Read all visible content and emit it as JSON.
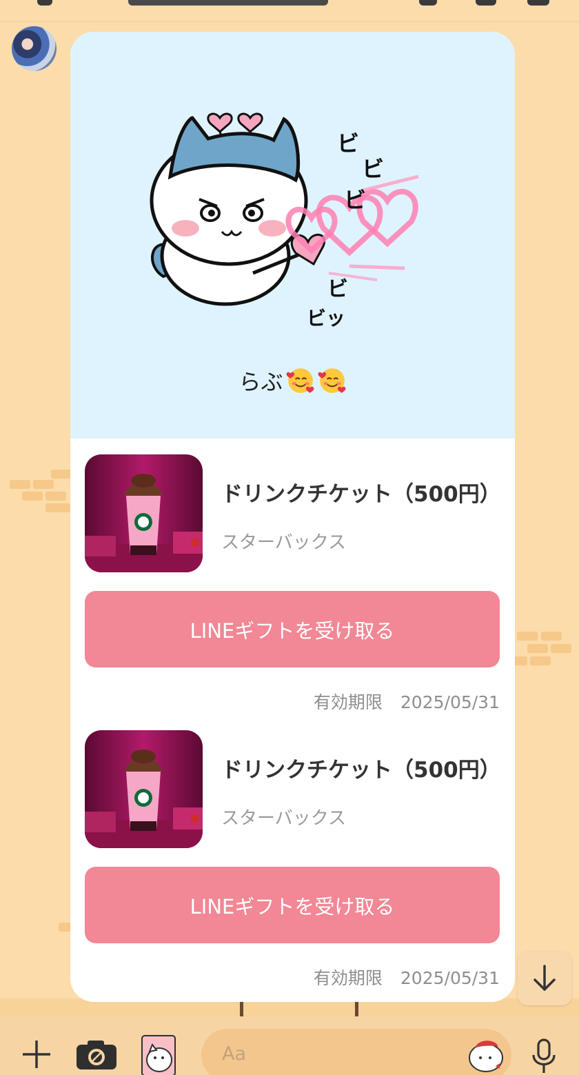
{
  "chat": {
    "message_text": "らぶ",
    "message_emoji": [
      "smiling-face-with-hearts",
      "smiling-face-with-hearts"
    ]
  },
  "sticker": {
    "icon": "chiikawa-cat-sticker",
    "text_parts": [
      "ビ",
      "ビ",
      "ビ",
      "ビ",
      "ビッ"
    ]
  },
  "gifts": [
    {
      "title": "ドリンクチケット（500円）",
      "brand": "スターバックス",
      "button_label": "LINEギフトを受け取る",
      "expiry_label": "有効期限",
      "expiry_date": "2025/05/31"
    },
    {
      "title": "ドリンクチケット（500円）",
      "brand": "スターバックス",
      "button_label": "LINEギフトを受け取る",
      "expiry_label": "有効期限",
      "expiry_date": "2025/05/31"
    }
  ],
  "input": {
    "placeholder": "Aa"
  },
  "colors": {
    "background": "#fbdcaa",
    "card_header": "#dff3ff",
    "button": "#f28795",
    "bottom_bar": "#f6d4a3"
  }
}
